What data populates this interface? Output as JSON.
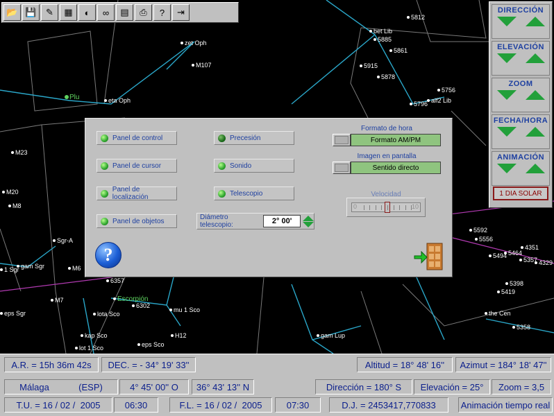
{
  "toolbar": {
    "buttons": [
      {
        "name": "open-icon",
        "glyph": "📂"
      },
      {
        "name": "save-icon",
        "glyph": "💾"
      },
      {
        "name": "edit-icon",
        "glyph": "✎"
      },
      {
        "name": "calendar-icon",
        "glyph": "▦"
      },
      {
        "name": "moon-phase-icon",
        "glyph": "◐"
      },
      {
        "name": "binoculars-icon",
        "glyph": "∞"
      },
      {
        "name": "panel-icon",
        "glyph": "▤"
      },
      {
        "name": "print-icon",
        "glyph": "⎙"
      },
      {
        "name": "help-icon",
        "glyph": "?"
      },
      {
        "name": "exit-icon",
        "glyph": "⇥"
      }
    ]
  },
  "sky": {
    "labels": [
      {
        "text": "zet Oph"
      },
      {
        "text": "M107"
      },
      {
        "text": "Plu"
      },
      {
        "text": "eta Oph"
      },
      {
        "text": "M23"
      },
      {
        "text": "M20"
      },
      {
        "text": "M8"
      },
      {
        "text": "Sgr-A"
      },
      {
        "text": "gam Sgr"
      },
      {
        "text": "M6"
      },
      {
        "text": "1 Sgr"
      },
      {
        "text": "6357"
      },
      {
        "text": "M7"
      },
      {
        "text": "Escorpión"
      },
      {
        "text": "6302"
      },
      {
        "text": "mu 1 Sco"
      },
      {
        "text": "eps Sgr"
      },
      {
        "text": "lota Sco"
      },
      {
        "text": "kap Sco"
      },
      {
        "text": "H12"
      },
      {
        "text": "eps Sco"
      },
      {
        "text": "lot 1 Sco"
      },
      {
        "text": "gam Lup"
      },
      {
        "text": "5812"
      },
      {
        "text": "bet Lib"
      },
      {
        "text": "5885"
      },
      {
        "text": "5861"
      },
      {
        "text": "5915"
      },
      {
        "text": "5878"
      },
      {
        "text": "5756"
      },
      {
        "text": "5796"
      },
      {
        "text": "alf2 Lib"
      },
      {
        "text": "5592"
      },
      {
        "text": "5556"
      },
      {
        "text": "5494"
      },
      {
        "text": "5464"
      },
      {
        "text": "4351"
      },
      {
        "text": "5357"
      },
      {
        "text": "4329"
      },
      {
        "text": "5398"
      },
      {
        "text": "5419"
      },
      {
        "text": "the Cen"
      },
      {
        "text": "5358"
      }
    ]
  },
  "right_panel": {
    "groups": [
      {
        "title": "DIRECCIÓN"
      },
      {
        "title": "ELEVACIÓN"
      },
      {
        "title": "ZOOM"
      },
      {
        "title": "FECHA/HORA"
      },
      {
        "title": "ANIMACIÓN"
      }
    ],
    "solar_day_button": "1 DIA SOLAR"
  },
  "dialog": {
    "options_left": [
      {
        "label": "Panel de control",
        "on": true
      },
      {
        "label": "Panel de cursor",
        "on": true
      },
      {
        "label": "Panel de localización",
        "on": true
      },
      {
        "label": "Panel de objetos",
        "on": true
      }
    ],
    "options_mid": [
      {
        "label": "Precesión",
        "on": false
      },
      {
        "label": "Sonido",
        "on": true
      },
      {
        "label": "Telescopio",
        "on": true
      }
    ],
    "time_format_label": "Formato de hora",
    "time_format_value": "Formato AM/PM",
    "screen_image_label": "Imagen en pantalla",
    "screen_image_value": "Sentido directo",
    "speed_label": "Velocidad",
    "speed_min": "0",
    "speed_max": "10",
    "speed_value": 5,
    "diameter_label": "Diámetro telescopio:",
    "diameter_value": "2° 00'"
  },
  "status": {
    "ra": "A.R. = 15h 36m 42s",
    "dec": "DEC. = - 34° 19' 33''",
    "altitude": "Altitud = 18° 48' 16''",
    "azimuth": "Azimut = 184° 18' 47''",
    "city": "Málaga",
    "country": "(ESP)",
    "longitude": "4° 45' 00'' O",
    "latitude": "36° 43' 13'' N",
    "direction": "Dirección = 180° S",
    "elevation": "Elevación = 25°",
    "zoom": "Zoom = 3,5",
    "tu_date": "T.U. = 16 / 02 /  2005",
    "tu_time": "06:30",
    "fl_date": "F.L. = 16 / 02 /  2005",
    "fl_time": "07:30",
    "jd": "D.J. = 2453417,770833",
    "animation": "Animación tiempo real"
  },
  "colors": {
    "accent": "#1d3fa0",
    "arrow": "#22a03a",
    "constellation": "#2aa6c8",
    "grid": "#7a7a7a"
  }
}
